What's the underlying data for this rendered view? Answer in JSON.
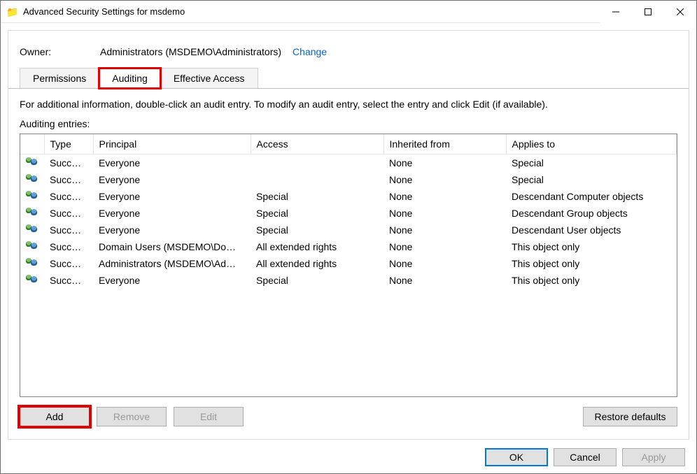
{
  "window": {
    "title": "Advanced Security Settings for msdemo"
  },
  "owner": {
    "label": "Owner:",
    "value": "Administrators (MSDEMO\\Administrators)",
    "change_link": "Change"
  },
  "tabs": {
    "permissions": "Permissions",
    "auditing": "Auditing",
    "effective_access": "Effective Access",
    "active": "auditing"
  },
  "info_text": "For additional information, double-click an audit entry. To modify an audit entry, select the entry and click Edit (if available).",
  "entries_label": "Auditing entries:",
  "columns": {
    "type": "Type",
    "principal": "Principal",
    "access": "Access",
    "inherited": "Inherited from",
    "applies": "Applies to"
  },
  "entries": [
    {
      "type": "Succ…",
      "principal": "Everyone",
      "access": "",
      "inherited": "None",
      "applies": "Special"
    },
    {
      "type": "Succ…",
      "principal": "Everyone",
      "access": "",
      "inherited": "None",
      "applies": "Special"
    },
    {
      "type": "Succ…",
      "principal": "Everyone",
      "access": "Special",
      "inherited": "None",
      "applies": "Descendant Computer objects"
    },
    {
      "type": "Succ…",
      "principal": "Everyone",
      "access": "Special",
      "inherited": "None",
      "applies": "Descendant Group objects"
    },
    {
      "type": "Succ…",
      "principal": "Everyone",
      "access": "Special",
      "inherited": "None",
      "applies": "Descendant User objects"
    },
    {
      "type": "Succ…",
      "principal": "Domain Users (MSDEMO\\Do…",
      "access": "All extended rights",
      "inherited": "None",
      "applies": "This object only"
    },
    {
      "type": "Succ…",
      "principal": "Administrators (MSDEMO\\Ad…",
      "access": "All extended rights",
      "inherited": "None",
      "applies": "This object only"
    },
    {
      "type": "Succ…",
      "principal": "Everyone",
      "access": "Special",
      "inherited": "None",
      "applies": "This object only"
    }
  ],
  "buttons": {
    "add": "Add",
    "remove": "Remove",
    "edit": "Edit",
    "restore": "Restore defaults"
  },
  "footer": {
    "ok": "OK",
    "cancel": "Cancel",
    "apply": "Apply"
  }
}
